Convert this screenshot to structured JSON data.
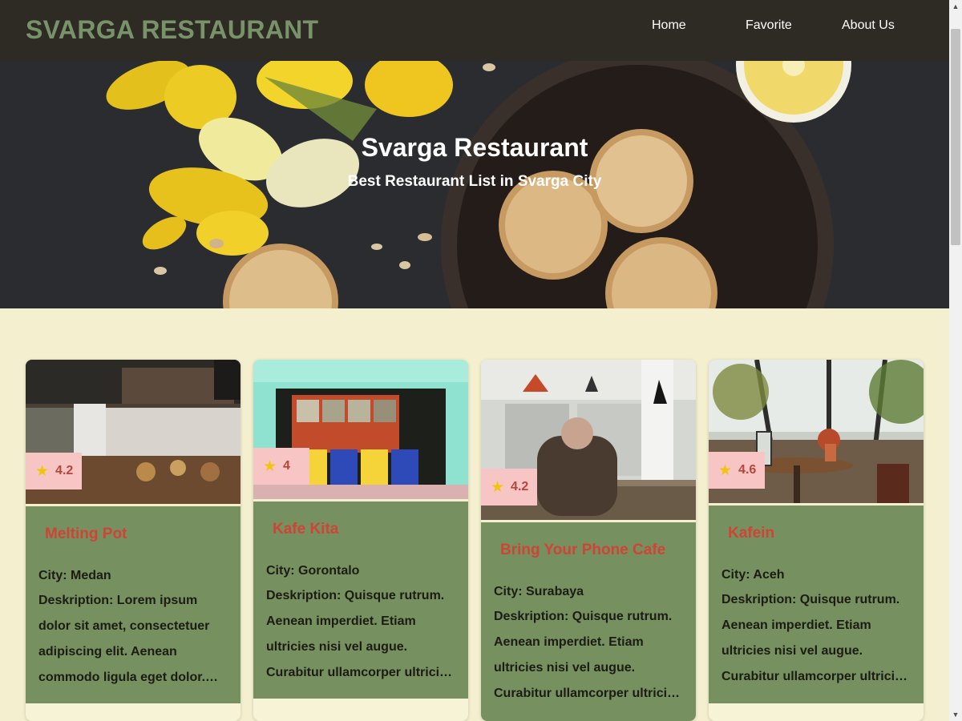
{
  "header": {
    "brand": "SVARGA RESTAURANT",
    "nav": [
      {
        "label": "Home"
      },
      {
        "label": "Favorite"
      },
      {
        "label": "About Us"
      }
    ]
  },
  "hero": {
    "title": "Svarga Restaurant",
    "subtitle": "Best Restaurant List in Svarga City"
  },
  "restaurants": [
    {
      "name": "Melting Pot",
      "rating": "4.2",
      "city": "City: Medan",
      "description": "Deskription: Lorem ipsum dolor sit amet, consectetuer adipiscing elit. Aenean commodo ligula eget dolor. Aenean massa."
    },
    {
      "name": "Kafe Kita",
      "rating": "4",
      "city": "City: Gorontalo",
      "description": "Deskription: Quisque rutrum. Aenean imperdiet. Etiam ultricies nisi vel augue. Curabitur ullamcorper ultricies nisi."
    },
    {
      "name": "Bring Your Phone Cafe",
      "rating": "4.2",
      "city": "City: Surabaya",
      "description": "Deskription: Quisque rutrum. Aenean imperdiet. Etiam ultricies nisi vel augue. Curabitur ullamcorper ultricies nisi."
    },
    {
      "name": "Kafein",
      "rating": "4.6",
      "city": "City: Aceh",
      "description": "Deskription: Quisque rutrum. Aenean imperdiet. Etiam ultricies nisi vel augue. Curabitur ullamcorper ultricies nisi."
    }
  ],
  "icons": {
    "rating": "star-icon"
  },
  "colors": {
    "navbar": "#2e2a24",
    "brand": "#78936a",
    "page_background": "#f4f0cf",
    "card_body": "#76905f",
    "restaurant_name": "#cf4436",
    "rating_badge": "#f7c6c4",
    "star": "#f1c40f"
  }
}
